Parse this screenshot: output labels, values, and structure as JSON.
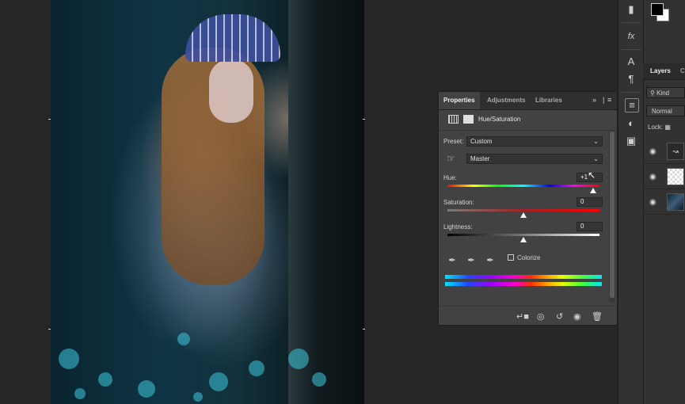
{
  "canvas": {
    "bokeh_color": "#3cc8dc"
  },
  "toolbar_right": {
    "icons": [
      "comment-icon",
      "fx-icon",
      "character-icon",
      "paragraph-icon"
    ]
  },
  "tool_panel_icons": [
    "adjustments-icon",
    "styles-icon",
    "libraries-icon"
  ],
  "layers": {
    "tab": "Layers",
    "tab_partial": "C",
    "kind_label": "Kind",
    "blend_mode": "Normal",
    "lock_label": "Lock:",
    "rows": [
      {
        "name": "hue-saturation-adjustment-layer"
      },
      {
        "name": "layer-checker-thumbnail"
      },
      {
        "name": "photo-layer-thumbnail"
      }
    ]
  },
  "properties": {
    "tabs": [
      "Properties",
      "Adjustments",
      "Libraries"
    ],
    "active_tab": "Properties",
    "title": "Hue/Saturation",
    "preset_label": "Preset:",
    "preset_value": "Custom",
    "channel_value": "Master",
    "hue_label": "Hue:",
    "hue_value": "+1",
    "saturation_label": "Saturation:",
    "saturation_value": "0",
    "lightness_label": "Lightness:",
    "lightness_value": "0",
    "colorize_label": "Colorize",
    "colorize_checked": false,
    "hue_fraction": 0.96,
    "saturation_fraction": 0.5,
    "lightness_fraction": 0.5
  },
  "colors": {
    "panel_bg": "#424242",
    "active_tab_text": "#f0f0f0",
    "app_bg": "#262626"
  }
}
